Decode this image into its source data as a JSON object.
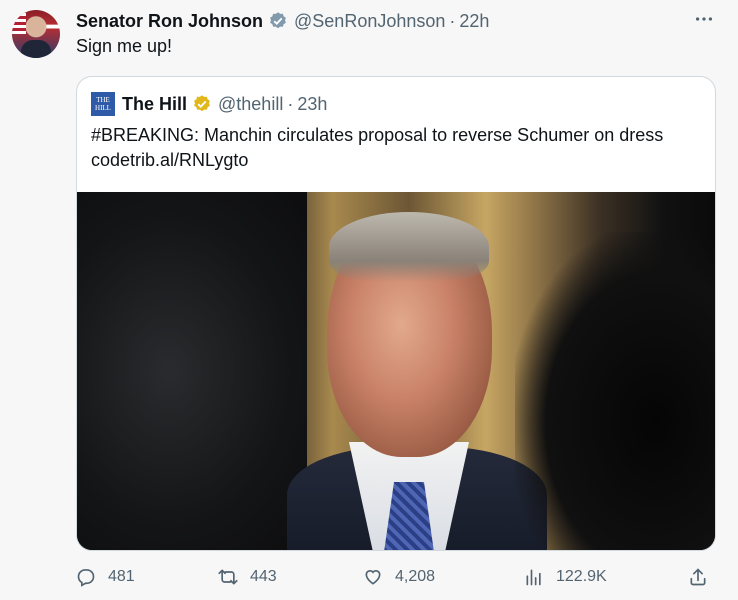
{
  "author": {
    "name": "Senator Ron Johnson",
    "handle": "@SenRonJohnson",
    "separator": "·",
    "time": "22h"
  },
  "tweet_text": "Sign me up!",
  "quoted": {
    "logo_text": "THE HILL",
    "name": "The Hill",
    "handle": "@thehill",
    "separator": "·",
    "time": "23h",
    "text_line1": "#BREAKING: Manchin circulates proposal to reverse Schumer on dress",
    "text_line2": "codetrib.al/RNLygto"
  },
  "actions": {
    "reply_count": "481",
    "retweet_count": "443",
    "like_count": "4,208",
    "view_count": "122.9K"
  },
  "icons": {
    "more": "more-icon",
    "verified": "verified-badge-icon",
    "reply": "reply-icon",
    "retweet": "retweet-icon",
    "like": "heart-icon",
    "views": "views-icon",
    "share": "share-icon"
  },
  "colors": {
    "verified_gray": "#829aab",
    "verified_gold": "#e2b719",
    "text_secondary": "#536471",
    "card_border": "#cfd9de"
  }
}
